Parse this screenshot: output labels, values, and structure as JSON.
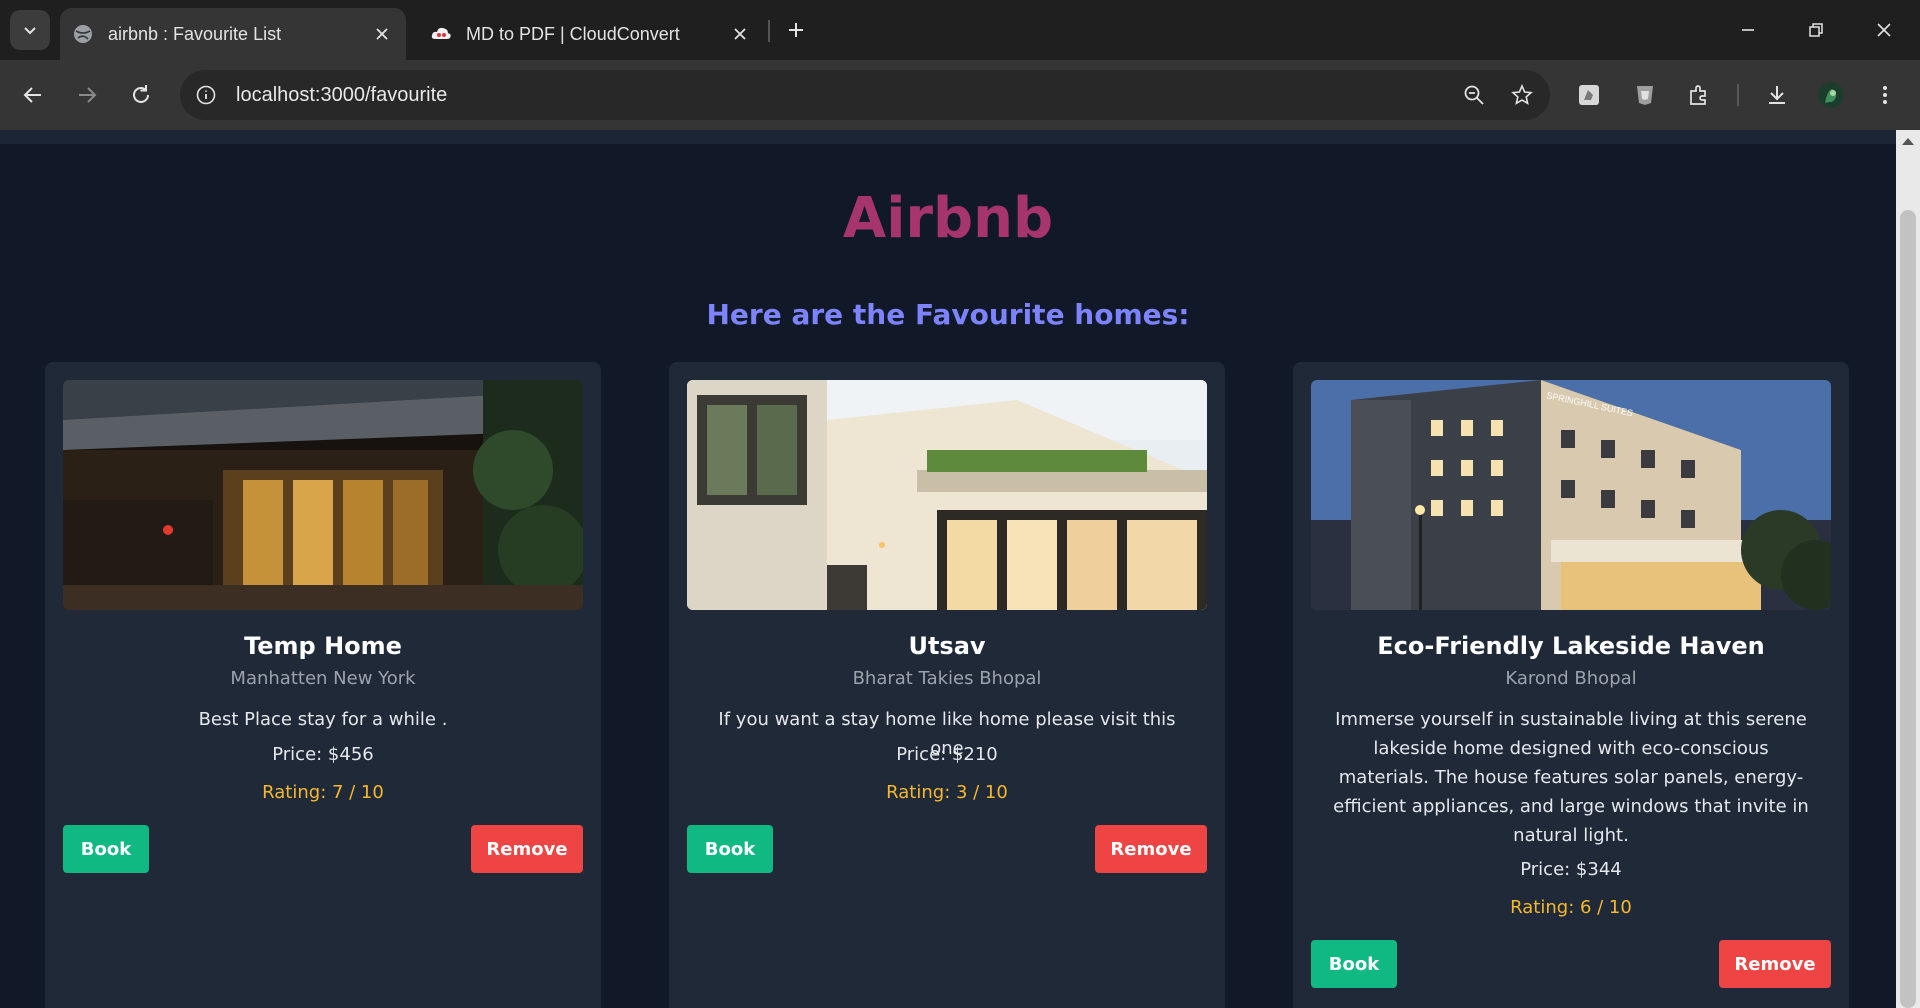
{
  "browser": {
    "tabs": [
      {
        "title": "airbnb : Favourite List",
        "active": true,
        "icon": "globe-icon"
      },
      {
        "title": "MD to PDF | CloudConvert",
        "active": false,
        "icon": "cloudconvert-icon"
      }
    ],
    "url": "localhost:3000/favourite"
  },
  "page": {
    "brand": "Airbnb",
    "subtitle": "Here are the Favourite homes:",
    "colors": {
      "brand": "#a6356e",
      "subtitle": "#7c83fd",
      "book": "#10b981",
      "remove": "#ef4444",
      "rating": "#f5b82e"
    }
  },
  "homes": [
    {
      "name": "Temp Home",
      "location": "Manhatten New York",
      "description": "Best Place stay for a while .",
      "price": "Price: $456",
      "rating": "Rating: 7 / 10",
      "book_label": "Book",
      "remove_label": "Remove"
    },
    {
      "name": "Utsav",
      "location": "Bharat Takies Bhopal",
      "description": "If you want a stay home like home please visit this one",
      "price": "Price: $210",
      "rating": "Rating: 3 / 10",
      "book_label": "Book",
      "remove_label": "Remove"
    },
    {
      "name": "Eco-Friendly Lakeside Haven",
      "location": "Karond Bhopal",
      "description": "Immerse yourself in sustainable living at this serene lakeside home designed with eco-conscious materials. The house features solar panels, energy-efficient appliances, and large windows that invite in natural light.",
      "price": "Price: $344",
      "rating": "Rating: 6 / 10",
      "book_label": "Book",
      "remove_label": "Remove",
      "photo_sign": "SPRINGHILL SUITES"
    }
  ]
}
